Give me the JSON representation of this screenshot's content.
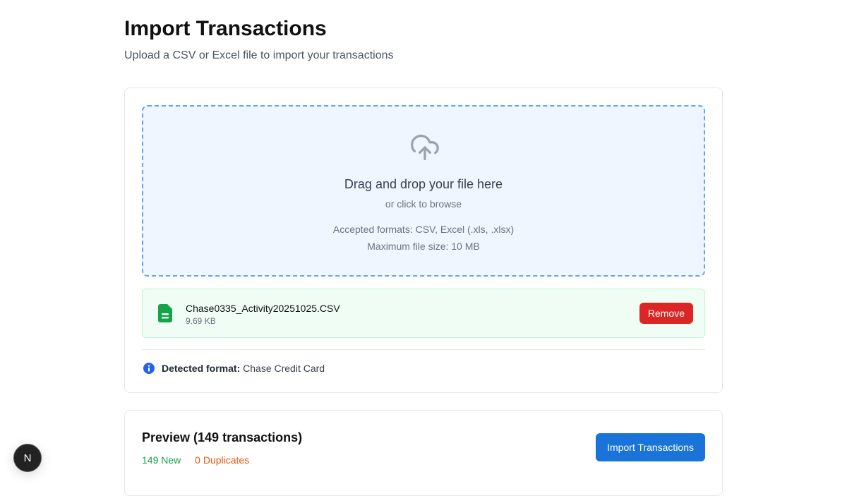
{
  "header": {
    "title": "Import Transactions",
    "subtitle": "Upload a CSV or Excel file to import your transactions"
  },
  "dropzone": {
    "icon": "cloud-upload-icon",
    "title": "Drag and drop your file here",
    "subtitle": "or click to browse",
    "formats": "Accepted formats: CSV, Excel (.xls, .xlsx)",
    "max_size": "Maximum file size: 10 MB"
  },
  "file": {
    "icon": "spreadsheet-file-icon",
    "name": "Chase0335_Activity20251025.CSV",
    "size": "9.69 KB",
    "remove_label": "Remove"
  },
  "detected": {
    "label": "Detected format:",
    "value": "Chase Credit Card"
  },
  "preview": {
    "title": "Preview (149 transactions)",
    "new": "149 New",
    "duplicates": "0 Duplicates",
    "import_label": "Import Transactions"
  },
  "dev_badge": {
    "label": "N"
  },
  "colors": {
    "accent": "#1a73d9",
    "danger": "#dc2626",
    "success": "#16a34a",
    "warning": "#ea580c"
  }
}
